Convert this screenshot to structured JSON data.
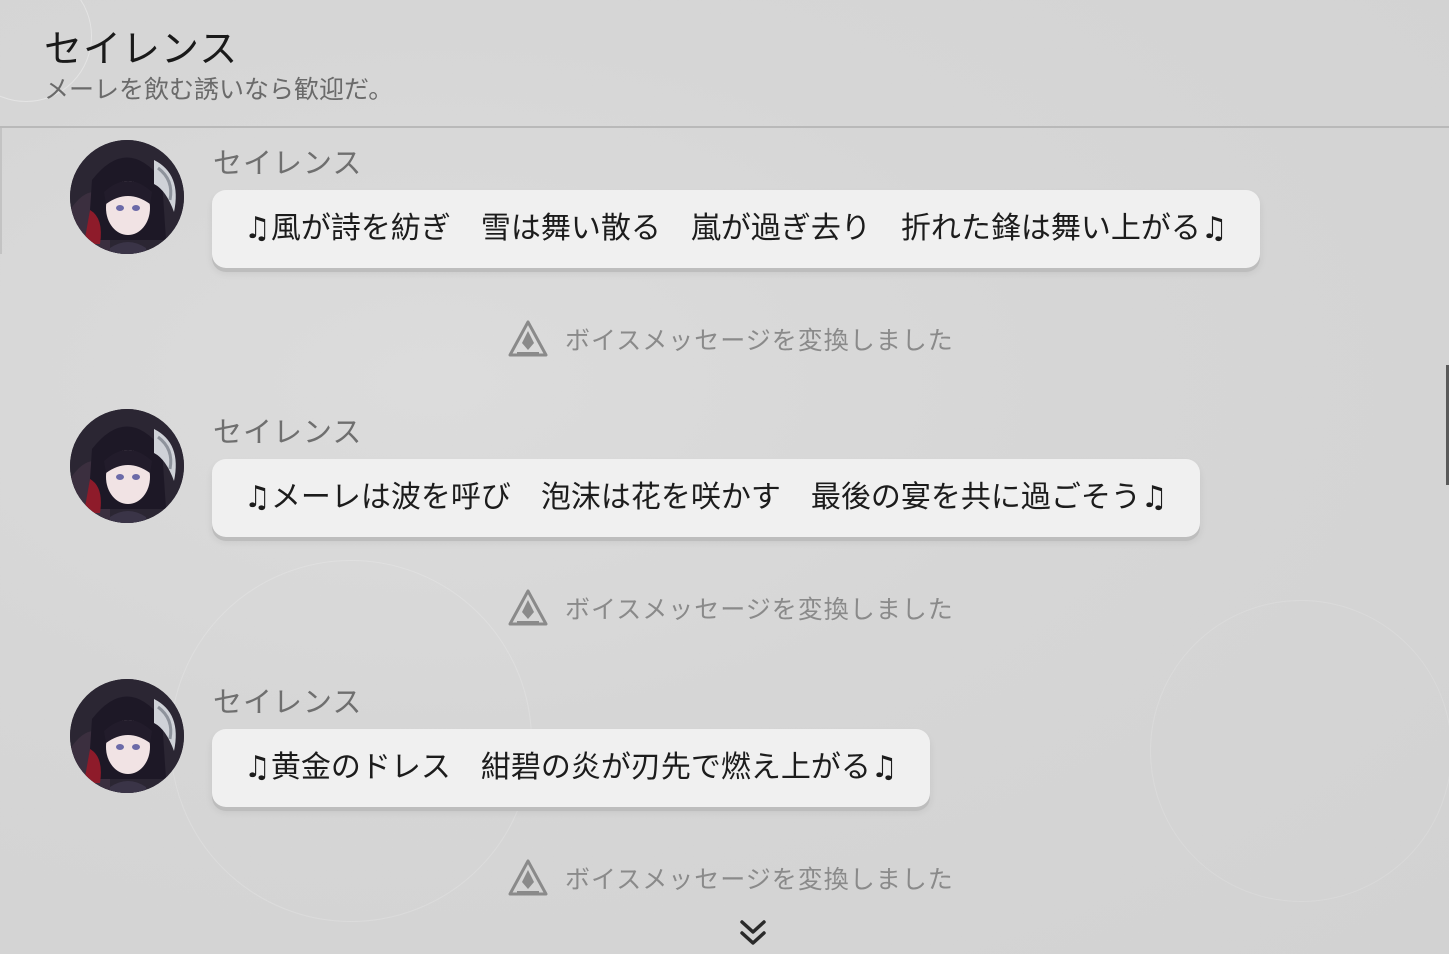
{
  "header": {
    "title": "セイレンス",
    "subtitle": "メーレを飲む誘いなら歓迎だ。"
  },
  "messages": [
    {
      "sender": "セイレンス",
      "text": "♫風が詩を紡ぎ　雪は舞い散る　嵐が過ぎ去り　折れた鋒は舞い上がる♫"
    },
    {
      "sender": "セイレンス",
      "text": "♫メーレは波を呼び　泡沫は花を咲かす　最後の宴を共に過ごそう♫"
    },
    {
      "sender": "セイレンス",
      "text": "♫黄金のドレス　紺碧の炎が刃先で燃え上がる♫"
    }
  ],
  "notices": [
    {
      "text": "ボイスメッセージを変換しました",
      "icon": "voice-convert-icon"
    },
    {
      "text": "ボイスメッセージを変換しました",
      "icon": "voice-convert-icon"
    },
    {
      "text": "ボイスメッセージを変換しました",
      "icon": "voice-convert-icon"
    }
  ],
  "icons": {
    "scroll_down": "double-chevron-down-icon"
  },
  "colors": {
    "background": "#d6d6d6",
    "bubble": "#f0f0f0",
    "notice_text": "#8a8a8a",
    "sender_text": "#6f6f6f"
  }
}
